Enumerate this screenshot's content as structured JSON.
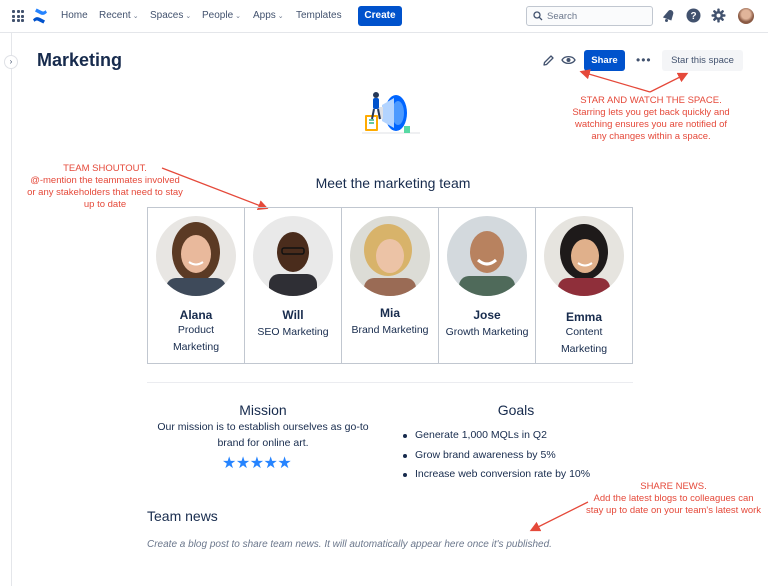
{
  "topbar": {
    "nav": [
      {
        "label": "Home",
        "dropdown": false
      },
      {
        "label": "Recent",
        "dropdown": true
      },
      {
        "label": "Spaces",
        "dropdown": true
      },
      {
        "label": "People",
        "dropdown": true
      },
      {
        "label": "Apps",
        "dropdown": true
      },
      {
        "label": "Templates",
        "dropdown": false
      }
    ],
    "create_label": "Create",
    "search_placeholder": "Search",
    "icons": [
      "app-switcher-icon",
      "confluence-logo-icon",
      "notifications-icon",
      "help-icon",
      "settings-icon",
      "profile-avatar"
    ]
  },
  "page": {
    "title": "Marketing",
    "share_label": "Share",
    "star_label": "Star this space"
  },
  "annotations": {
    "star_watch": "STAR  AND WATCH THE SPACE.\nStarring lets you get back quickly and watching ensures you are notified of any changes within a space.",
    "shoutout": "TEAM SHOUTOUT.\n@-mention the teammates involved or any stakeholders that need to stay up to date",
    "share_news": "SHARE NEWS.\nAdd the latest blogs to colleagues can stay up to date on your team's latest work"
  },
  "team": {
    "heading": "Meet the marketing team",
    "members": [
      {
        "name": "Alana",
        "role": "Product Marketing"
      },
      {
        "name": "Will",
        "role": "SEO Marketing"
      },
      {
        "name": "Mia",
        "role": "Brand Marketing"
      },
      {
        "name": "Jose",
        "role": "Growth Marketing"
      },
      {
        "name": "Emma",
        "role": "Content Marketing"
      }
    ]
  },
  "mission": {
    "heading": "Mission",
    "text": "Our mission is to establish ourselves as go-to brand for online art.",
    "stars": "★★★★★",
    "rating": 5
  },
  "goals": {
    "heading": "Goals",
    "items": [
      "Generate 1,000 MQLs in Q2",
      "Grow brand awareness by 5%",
      "Increase web conversion rate by 10%"
    ]
  },
  "news": {
    "heading": "Team news",
    "empty_text": "Create a blog post to share team news. It will automatically appear here once it's published."
  },
  "colors": {
    "accent": "#0052cc",
    "annotation": "#e5493a",
    "star": "#2684ff"
  }
}
